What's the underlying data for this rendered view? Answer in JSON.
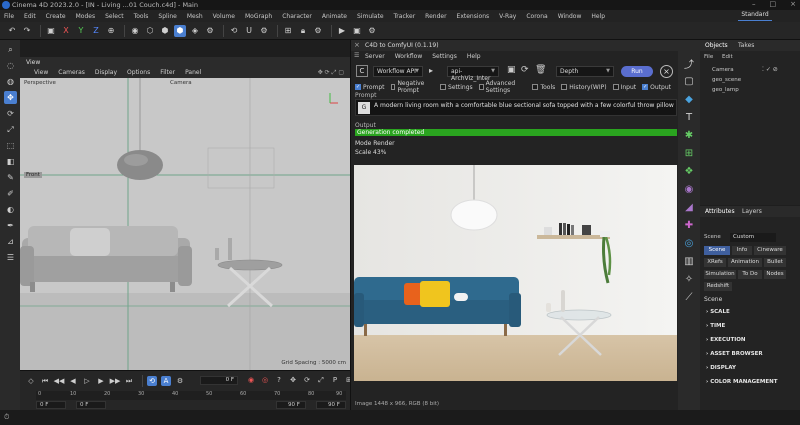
{
  "app": {
    "title": "Cinema 4D 2023.2.0 - [IN - Living ...01 Couch.c4d] - Main",
    "layout": "Standard"
  },
  "menubar": [
    "File",
    "Edit",
    "Create",
    "Modes",
    "Select",
    "Tools",
    "Spline",
    "Mesh",
    "Volume",
    "MoGraph",
    "Character",
    "Animate",
    "Simulate",
    "Tracker",
    "Render",
    "Extensions",
    "V-Ray",
    "Corona",
    "Window",
    "Help"
  ],
  "viewport": {
    "tab": "View",
    "menu": [
      "View",
      "Cameras",
      "Display",
      "Options",
      "Filter",
      "Panel"
    ],
    "perspective_label": "Perspective",
    "camera_label": "Camera",
    "axis_label": "Front",
    "grid_spacing": "Grid Spacing : 5000 cm"
  },
  "timeline": {
    "current_frame": "0 F",
    "ruler": [
      "0",
      "10",
      "20",
      "30",
      "40",
      "50",
      "60",
      "70",
      "80",
      "90"
    ],
    "start": "0 F",
    "end1": "90 F",
    "end2": "90 F",
    "start_left": "0 F"
  },
  "plugin": {
    "title": "C4D to ComfyUI (0.1.19)",
    "menu": [
      "Server",
      "Workflow",
      "Settings",
      "Help"
    ],
    "workflow": "Workflow API",
    "workflow_file": "api-ArchViz_Inter",
    "mode": "Depth",
    "run": "Run",
    "checks": [
      {
        "label": "Prompt",
        "on": true
      },
      {
        "label": "Negative Prompt",
        "on": false
      },
      {
        "label": "Settings",
        "on": false
      },
      {
        "label": "Advanced Settings",
        "on": false
      },
      {
        "label": "Tools",
        "on": false
      },
      {
        "label": "History(WIP)",
        "on": false
      },
      {
        "label": "Input",
        "on": false
      },
      {
        "label": "Output",
        "on": true
      }
    ],
    "prompt_label": "Prompt",
    "prompt_text": "A modern living room with a comfortable blue sectional sofa topped with a few colorful throw pillows in orange an",
    "output_label": "Output",
    "status": "Generation completed",
    "mode_render": "Mode Render",
    "scale": "Scale 43%",
    "image_info": "Image 1448 x 966, RGB (8 bit)"
  },
  "objects": {
    "tabs": [
      "Objects",
      "Takes"
    ],
    "menu": [
      "File",
      "Edit"
    ],
    "items": [
      "Camera",
      "geo_scene",
      "geo_lamp"
    ]
  },
  "attributes": {
    "tabs": [
      "Attributes",
      "Layers"
    ],
    "mode_label": "Scene",
    "mode_value": "Custom",
    "chips": [
      "Scene",
      "Info",
      "Cineware",
      "XRefs",
      "Animation",
      "Bullet",
      "Simulation",
      "To Do",
      "Nodes",
      "Redshift"
    ],
    "section": "Scene",
    "groups": [
      "SCALE",
      "TIME",
      "EXECUTION",
      "ASSET BROWSER",
      "DISPLAY",
      "COLOR MANAGEMENT"
    ]
  },
  "colors": {
    "accent": "#4a7fd0",
    "progress": "#2aa41f",
    "run": "#5a6ecf",
    "sofa": "#2f6a8e"
  }
}
